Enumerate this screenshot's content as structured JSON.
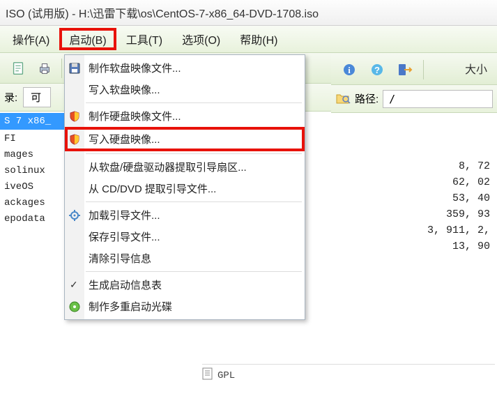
{
  "title": "ISO (试用版) - H:\\迅雷下载\\os\\CentOS-7-x86_64-DVD-1708.iso",
  "menubar": {
    "action": "操作(A)",
    "boot": "启动(B)",
    "tools": "工具(T)",
    "options": "选项(O)",
    "help": "帮助(H)"
  },
  "dropdown": {
    "make_floppy": "制作软盘映像文件...",
    "write_floppy": "写入软盘映像...",
    "make_hdd": "制作硬盘映像文件...",
    "write_hdd": "写入硬盘映像...",
    "extract_floppy": "从软盘/硬盘驱动器提取引导扇区...",
    "extract_cd": "从 CD/DVD 提取引导文件...",
    "load_boot": "加载引导文件...",
    "save_boot": "保存引导文件...",
    "clear_boot": "清除引导信息",
    "gen_info": "生成启动信息表",
    "make_multi": "制作多重启动光碟"
  },
  "left": {
    "label_prefix": "录:",
    "dropdown_text": "可",
    "selected": "S 7 x86_",
    "items": [
      "FI",
      "mages",
      "solinux",
      "iveOS",
      "ackages",
      "epodata"
    ]
  },
  "right": {
    "size_header": "大小",
    "path_label": "路径:",
    "path_value": "/",
    "sizes": [
      "8, 72",
      "62, 02",
      "53, 40",
      "359, 93",
      "3, 911, 2,",
      "13, 90"
    ]
  },
  "bottom": {
    "file_label": "GPL"
  },
  "colors": {
    "highlight": "#e8120a",
    "selection": "#3399ff"
  }
}
